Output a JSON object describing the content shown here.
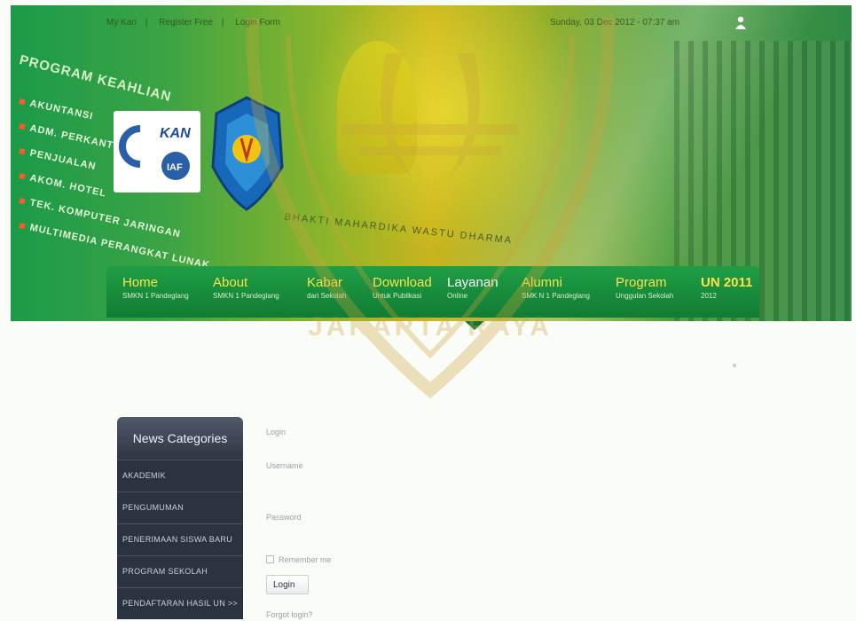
{
  "header": {
    "top_links": [
      "My Kan",
      "Register Free",
      "Login Form"
    ],
    "date_text": "Sunday, 03 Dec 2012 - 07:37 am",
    "program": {
      "title": "PROGRAM KEAHLIAN",
      "items": [
        "AKUNTANSI",
        "ADM. PERKANTORAN",
        "PENJUALAN",
        "AKOM. HOTEL",
        "TEK. KOMPUTER JARINGAN",
        "MULTIMEDIA PERANGKAT LUNAK"
      ]
    },
    "cert_logo_text": "KAN",
    "cert_logo_badge": "IAF",
    "motto": "BHAKTI MAHARDIKA WASTU DHARMA"
  },
  "nav": {
    "items": [
      {
        "title": "Home",
        "sub": "SMKN 1 Pandeglang"
      },
      {
        "title": "About",
        "sub": "SMKN 1 Pandeglang"
      },
      {
        "title": "Kabar",
        "sub": "dari Sekolah"
      },
      {
        "title": "Download",
        "sub": "Untuk Publikasi"
      },
      {
        "title": "Layanan",
        "sub": "Online"
      },
      {
        "title": "Alumni",
        "sub": "SMK N 1 Pandeglang"
      },
      {
        "title": "Program",
        "sub": "Unggulan Sekolah"
      },
      {
        "title": "UN 2011",
        "sub": "2012"
      }
    ]
  },
  "watermark": {
    "text": "JAKARTA RAYA",
    "color": "#c9a53a"
  },
  "sidebar": {
    "title": "News Categories",
    "items": [
      "AKADEMIK",
      "PENGUMUMAN",
      "PENERIMAAN SISWA BARU",
      "PROGRAM SEKOLAH",
      "PENDAFTARAN HASIL UN >>"
    ]
  },
  "login": {
    "heading": "Login",
    "username_label": "Username",
    "password_label": "Password",
    "remember_label": "Remember me",
    "button_label": "Login",
    "forgot_label": "Forgot login?"
  },
  "colors": {
    "nav_bg": "#1a9140",
    "nav_title": "#ffe24a",
    "sidebar_bg": "#2c3340"
  }
}
